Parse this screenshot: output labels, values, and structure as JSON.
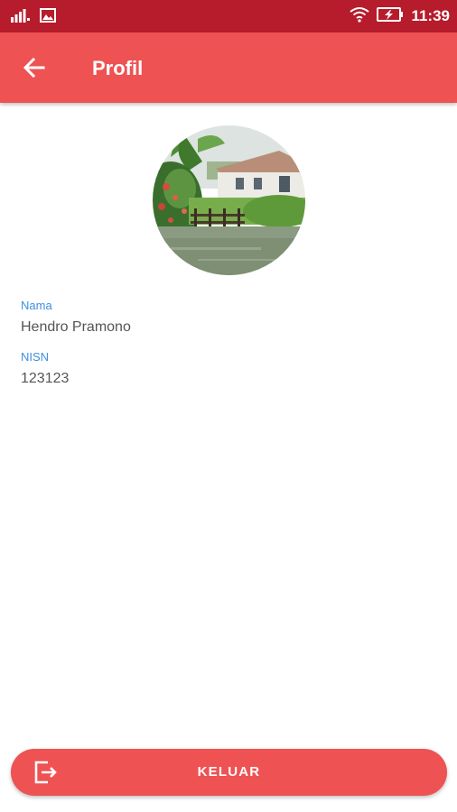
{
  "status_bar": {
    "time": "11:39",
    "icons": [
      "signal-icon",
      "gallery-icon",
      "wifi-icon",
      "battery-charging-icon"
    ]
  },
  "app_bar": {
    "title": "Profil",
    "back_icon": "arrow-left-icon"
  },
  "profile": {
    "avatar": "landscape-photo",
    "name_label": "Nama",
    "name_value": "Hendro Pramono",
    "nisn_label": "NISN",
    "nisn_value": "123123"
  },
  "logout": {
    "label": "KELUAR",
    "icon": "logout-icon"
  },
  "colors": {
    "status_bar": "#b71c2c",
    "primary": "#ee5253",
    "label_blue": "#3d8fe0",
    "value_gray": "#555555"
  }
}
